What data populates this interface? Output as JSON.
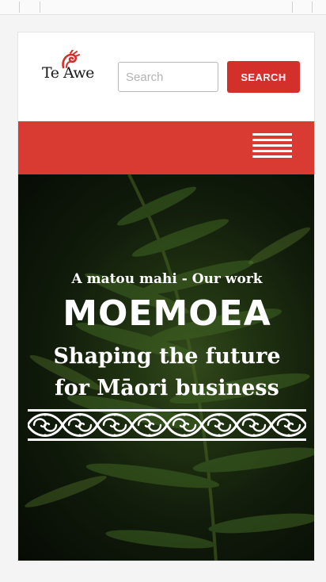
{
  "header": {
    "logo_text": "Te Awe",
    "search": {
      "placeholder": "Search",
      "value": ""
    },
    "search_button_label": "SEARCH"
  },
  "nav": {
    "menu_icon": "hamburger-menu-icon"
  },
  "hero": {
    "eyebrow": "A matou mahi - Our work",
    "title": "MOEMOEA",
    "subtitle": "Shaping the future for Māori business",
    "pattern_icon": "koru-pattern-divider"
  },
  "colors": {
    "accent": "#d4302b",
    "nav_background": "#d93a31",
    "hero_text": "#ffffff"
  }
}
